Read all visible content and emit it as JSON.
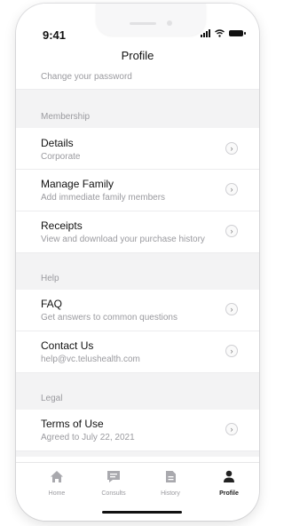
{
  "status": {
    "time": "9:41"
  },
  "header": {
    "title": "Profile"
  },
  "rows": {
    "password": {
      "subtitle": "Change your password"
    },
    "membership_section": "Membership",
    "details": {
      "title": "Details",
      "subtitle": "Corporate"
    },
    "family": {
      "title": "Manage Family",
      "subtitle": "Add immediate family members"
    },
    "receipts": {
      "title": "Receipts",
      "subtitle": "View and download your purchase history"
    },
    "help_section": "Help",
    "faq": {
      "title": "FAQ",
      "subtitle": "Get answers to common questions"
    },
    "contact": {
      "title": "Contact Us",
      "subtitle": "help@vc.telushealth.com"
    },
    "legal_section": "Legal",
    "terms": {
      "title": "Terms of Use",
      "subtitle": "Agreed to July 22, 2021"
    }
  },
  "tabs": {
    "home": "Home",
    "consults": "Consults",
    "history": "History",
    "profile": "Profile"
  },
  "colors": {
    "accent": "#111111",
    "muted": "#9a9a9f",
    "background": "#f3f3f4"
  }
}
